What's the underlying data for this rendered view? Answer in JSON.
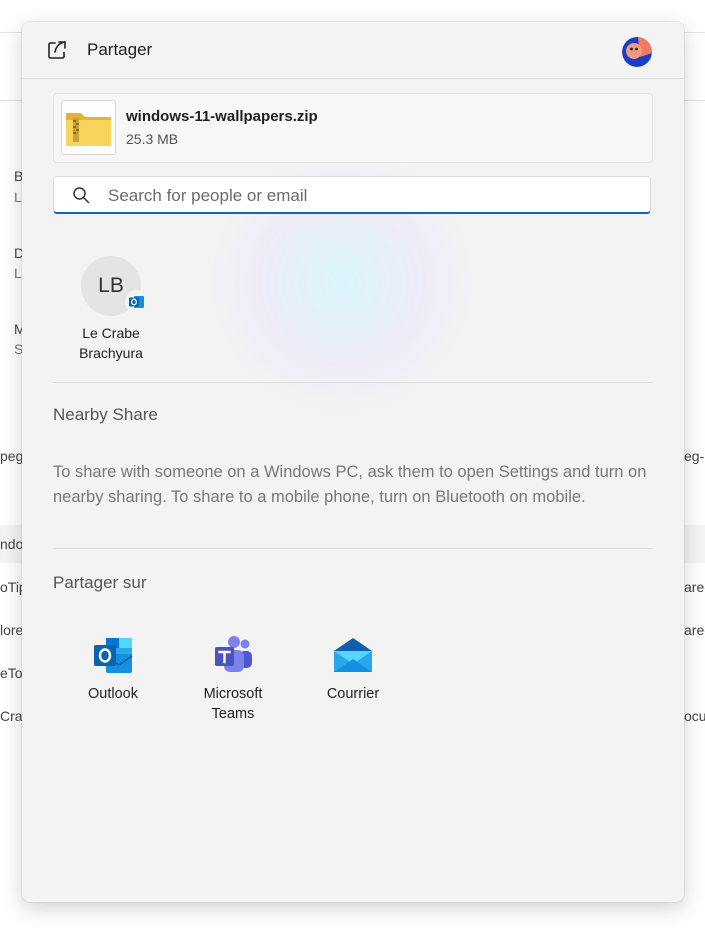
{
  "background": {
    "rows": [
      {
        "text": "B"
      },
      {
        "text": "Le"
      },
      {
        "text": "D"
      },
      {
        "text": "Le"
      },
      {
        "text": "M"
      },
      {
        "text": "St"
      },
      {
        "text": "peg"
      },
      {
        "text": "eg-("
      },
      {
        "text": "ndov"
      },
      {
        "text": "oTip"
      },
      {
        "text": "are-"
      },
      {
        "text": "lore"
      },
      {
        "text": "are-"
      },
      {
        "text": "eTo"
      },
      {
        "text": "Crat"
      },
      {
        "text": "ocu"
      }
    ]
  },
  "header": {
    "title": "Partager",
    "share_icon": "share-icon",
    "avatar_icon": "account-avatar"
  },
  "file": {
    "name": "windows-11-wallpapers.zip",
    "size": "25.3 MB",
    "icon": "zip-folder-icon"
  },
  "search": {
    "placeholder": "Search for people or email",
    "value": "",
    "accent": "#0f67b8"
  },
  "contacts": [
    {
      "initials": "LB",
      "name_line1": "Le Crabe",
      "name_line2": "Brachyura",
      "badge": "outlook-icon"
    }
  ],
  "nearby": {
    "title": "Nearby Share",
    "description": "To share with someone on a Windows PC, ask them to open Settings and turn on nearby sharing. To share to a mobile phone, turn on Bluetooth on mobile."
  },
  "share_to": {
    "title": "Partager sur",
    "apps": [
      {
        "label_line1": "Outlook",
        "label_line2": "",
        "icon": "outlook-icon"
      },
      {
        "label_line1": "Microsoft",
        "label_line2": "Teams",
        "icon": "teams-icon"
      },
      {
        "label_line1": "Courrier",
        "label_line2": "",
        "icon": "mail-icon"
      }
    ]
  }
}
